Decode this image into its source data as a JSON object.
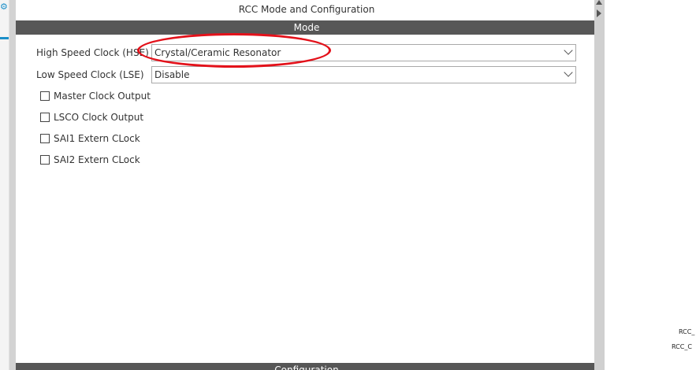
{
  "panel": {
    "title": "RCC Mode and Configuration",
    "mode_header": "Mode",
    "config_header": "Configuration"
  },
  "mode": {
    "hse": {
      "label": "High Speed Clock (HSE)",
      "value": "Crystal/Ceramic Resonator"
    },
    "lse": {
      "label": "Low Speed Clock (LSE)",
      "value": "Disable"
    },
    "checkboxes": [
      {
        "label": "Master Clock Output",
        "checked": false
      },
      {
        "label": "LSCO Clock Output",
        "checked": false
      },
      {
        "label": "SAI1 Extern CLock",
        "checked": false
      },
      {
        "label": "SAI2 Extern CLock",
        "checked": false
      }
    ]
  },
  "canvas": {
    "pin_labels": [
      "RCC_",
      "RCC_C"
    ]
  },
  "colors": {
    "section_bar": "#575757",
    "annotation": "#e3111a",
    "accent": "#1b8fc9"
  },
  "icons": {
    "left_gear": "gear-icon"
  }
}
